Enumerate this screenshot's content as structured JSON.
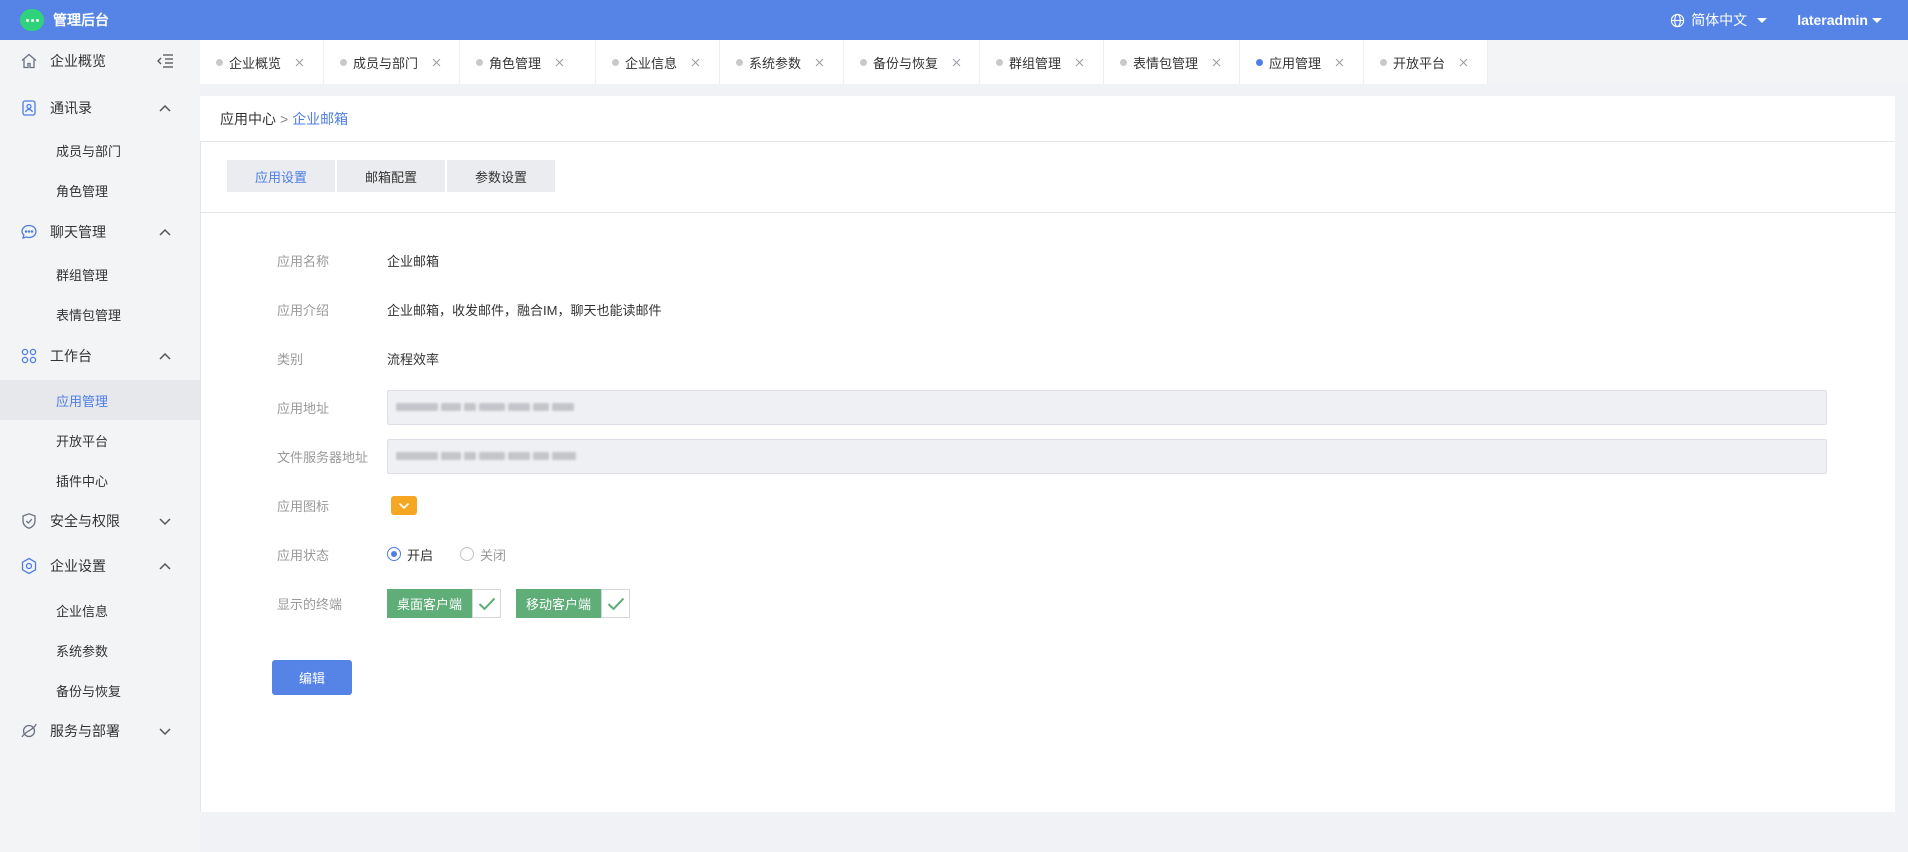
{
  "app": {
    "title": "管理后台"
  },
  "header": {
    "language": "简体中文",
    "username": "lateradmin"
  },
  "sidebar": {
    "groups": [
      {
        "label": "企业概览",
        "icon": "home-icon"
      },
      {
        "label": "通讯录",
        "icon": "contacts-icon",
        "items": [
          "成员与部门",
          "角色管理"
        ]
      },
      {
        "label": "聊天管理",
        "icon": "chat-icon",
        "items": [
          "群组管理",
          "表情包管理"
        ]
      },
      {
        "label": "工作台",
        "icon": "grid-icon",
        "items": [
          "应用管理",
          "开放平台",
          "插件中心"
        ]
      },
      {
        "label": "安全与权限",
        "icon": "shield-icon"
      },
      {
        "label": "企业设置",
        "icon": "settings-icon",
        "items": [
          "企业信息",
          "系统参数",
          "备份与恢复"
        ]
      },
      {
        "label": "服务与部署",
        "icon": "planet-icon"
      }
    ],
    "active_item": "应用管理"
  },
  "tabs": [
    {
      "label": "企业概览"
    },
    {
      "label": "成员与部门"
    },
    {
      "label": "角色管理"
    },
    {
      "label": "企业信息"
    },
    {
      "label": "系统参数"
    },
    {
      "label": "备份与恢复"
    },
    {
      "label": "群组管理"
    },
    {
      "label": "表情包管理"
    },
    {
      "label": "应用管理",
      "active": true
    },
    {
      "label": "开放平台"
    }
  ],
  "breadcrumb": {
    "parent": "应用中心",
    "separator": ">",
    "current": "企业邮箱"
  },
  "subtabs": [
    {
      "label": "应用设置",
      "active": true
    },
    {
      "label": "邮箱配置"
    },
    {
      "label": "参数设置"
    }
  ],
  "form": {
    "app_name": {
      "label": "应用名称",
      "value": "企业邮箱"
    },
    "app_intro": {
      "label": "应用介绍",
      "value": "企业邮箱，收发邮件，融合IM，聊天也能读邮件"
    },
    "category": {
      "label": "类别",
      "value": "流程效率"
    },
    "app_address": {
      "label": "应用地址"
    },
    "file_server_address": {
      "label": "文件服务器地址"
    },
    "app_icon": {
      "label": "应用图标",
      "icon": "chevron-down-icon",
      "color": "#f5a623"
    },
    "app_status": {
      "label": "应用状态",
      "options": [
        "开启",
        "关闭"
      ],
      "selected": "开启"
    },
    "terminals": {
      "label": "显示的终端",
      "options": [
        {
          "label": "桌面客户端",
          "checked": true
        },
        {
          "label": "移动客户端",
          "checked": true
        }
      ]
    }
  },
  "actions": {
    "edit_label": "编辑"
  },
  "colors": {
    "primary": "#5584e6",
    "accent": "#4e7de4",
    "success": "#5fae78",
    "warning": "#f5a623"
  }
}
